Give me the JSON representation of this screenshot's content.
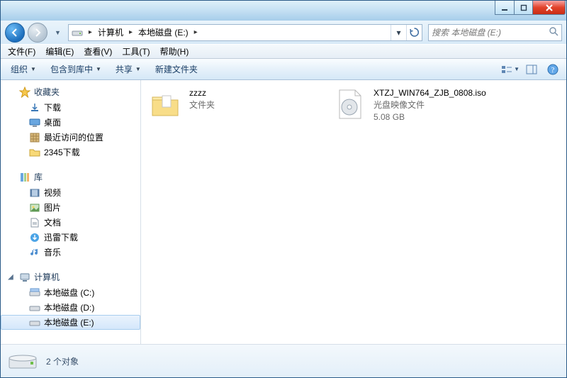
{
  "title_controls": {
    "min": "–",
    "max": "❐",
    "close": "✕"
  },
  "nav": {
    "back_tip": "后退",
    "fwd_tip": "前进"
  },
  "address": {
    "segments": [
      "计算机",
      "本地磁盘 (E:)"
    ],
    "refresh_tip": "刷新"
  },
  "search": {
    "placeholder": "搜索 本地磁盘 (E:)"
  },
  "menus": [
    "文件(F)",
    "编辑(E)",
    "查看(V)",
    "工具(T)",
    "帮助(H)"
  ],
  "toolbar": {
    "organize": "组织",
    "include": "包含到库中",
    "share": "共享",
    "newfolder": "新建文件夹"
  },
  "sidebar": {
    "favorites": {
      "label": "收藏夹",
      "items": [
        "下载",
        "桌面",
        "最近访问的位置",
        "2345下载"
      ]
    },
    "libraries": {
      "label": "库",
      "items": [
        "视频",
        "图片",
        "文档",
        "迅雷下载",
        "音乐"
      ]
    },
    "computer": {
      "label": "计算机",
      "items": [
        "本地磁盘 (C:)",
        "本地磁盘 (D:)",
        "本地磁盘 (E:)"
      ]
    }
  },
  "items": [
    {
      "name": "zzzz",
      "type": "文件夹",
      "size": ""
    },
    {
      "name": "XTZJ_WIN764_ZJB_0808.iso",
      "type": "光盘映像文件",
      "size": "5.08 GB"
    }
  ],
  "status": {
    "count": "2 个对象"
  }
}
